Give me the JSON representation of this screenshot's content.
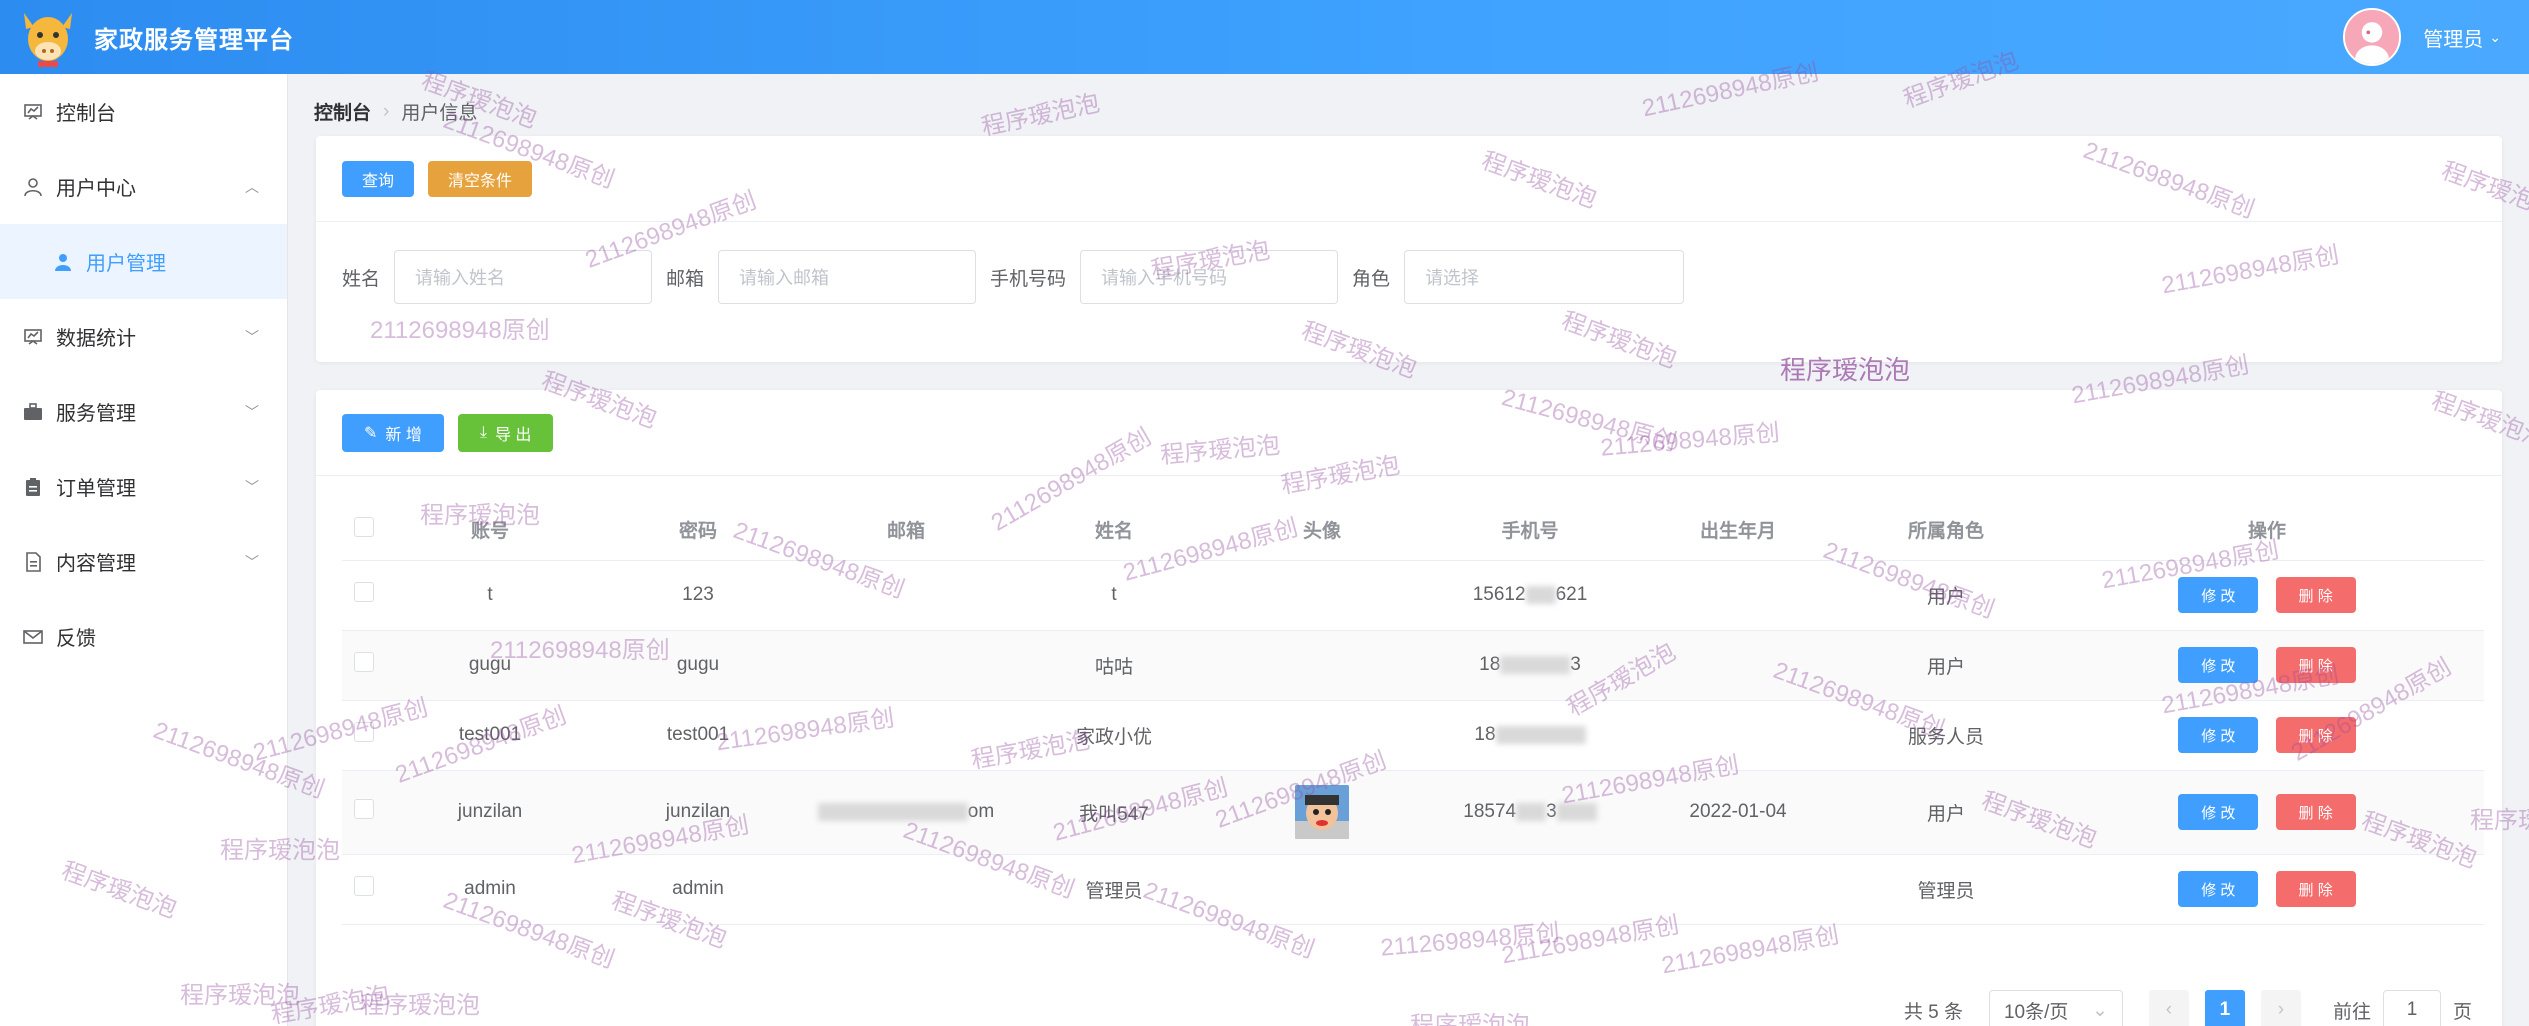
{
  "header": {
    "app_title": "家政服务管理平台",
    "user_name": "管理员",
    "user_caret": "⌄"
  },
  "sidebar": {
    "items": [
      {
        "label": "控制台",
        "icon": "dashboard-icon"
      },
      {
        "label": "用户中心",
        "icon": "user-icon",
        "expanded": true
      },
      {
        "label": "用户管理",
        "icon": "person-icon",
        "active": true
      },
      {
        "label": "数据统计",
        "icon": "chart-icon"
      },
      {
        "label": "服务管理",
        "icon": "briefcase-icon"
      },
      {
        "label": "订单管理",
        "icon": "clipboard-icon"
      },
      {
        "label": "内容管理",
        "icon": "document-icon"
      },
      {
        "label": "反馈",
        "icon": "mail-icon"
      }
    ]
  },
  "breadcrumb": {
    "home": "控制台",
    "current": "用户信息"
  },
  "search": {
    "query_label": "查询",
    "clear_label": "清空条件",
    "name_label": "姓名",
    "name_placeholder": "请输入姓名",
    "email_label": "邮箱",
    "email_placeholder": "请输入邮箱",
    "phone_label": "手机号码",
    "phone_placeholder": "请输入手机号码",
    "role_label": "角色",
    "role_placeholder": "请选择"
  },
  "toolbar": {
    "add_label": "新 增",
    "export_label": "导 出"
  },
  "table": {
    "headers": [
      "账号",
      "密码",
      "邮箱",
      "姓名",
      "头像",
      "手机号",
      "出生年月",
      "所属角色",
      "操作"
    ],
    "rows": [
      {
        "account": "t",
        "password": "123",
        "email": "",
        "name": "t",
        "phone": "15612",
        "phone_tail": "621",
        "birth": "",
        "role": "用户"
      },
      {
        "account": "gugu",
        "password": "gugu",
        "email": "",
        "name": "咕咕",
        "phone": "18",
        "phone_tail": "3",
        "birth": "",
        "role": "用户"
      },
      {
        "account": "test001",
        "password": "test001",
        "email": "",
        "name": "家政小优",
        "phone": "18",
        "phone_tail": "",
        "birth": "",
        "role": "服务人员"
      },
      {
        "account": "junzilan",
        "password": "junzilan",
        "email": "om",
        "name": "我叫547",
        "phone": "18574",
        "phone_tail": "3",
        "birth": "2022-01-04",
        "role": "用户"
      },
      {
        "account": "admin",
        "password": "admin",
        "email": "",
        "name": "管理员",
        "phone": "",
        "phone_tail": "",
        "birth": "",
        "role": "管理员"
      }
    ],
    "edit_label": "修 改",
    "delete_label": "删 除"
  },
  "pagination": {
    "total": "共 5 条",
    "page_size": "10条/页",
    "current_page": "1",
    "goto_label": "前往",
    "goto_value": "1",
    "page_suffix": "页"
  },
  "watermarks": {
    "text_a": "程序瑷泡泡",
    "text_b": "2112698948原创"
  },
  "colors": {
    "primary": "#409eff",
    "warning": "#e6a23c",
    "success": "#67c23a",
    "danger": "#f56c6c",
    "header": "#2d8cf0"
  }
}
